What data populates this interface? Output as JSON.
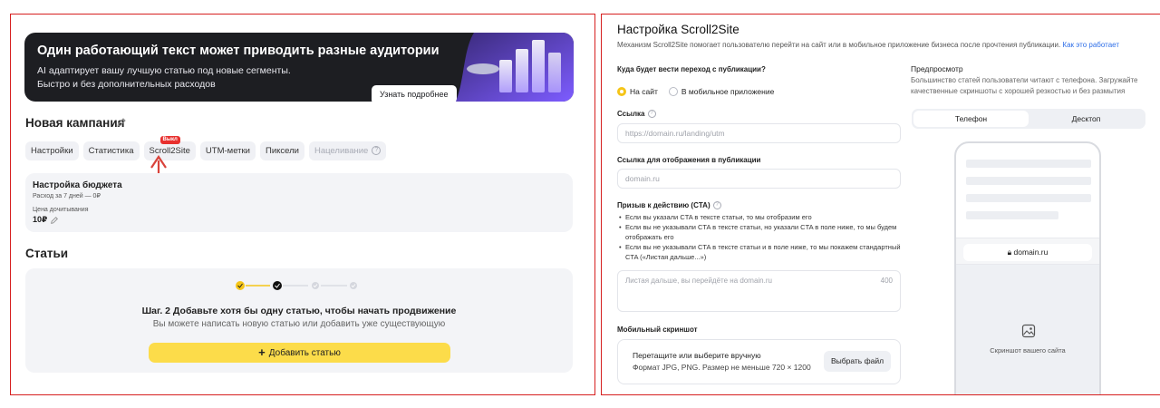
{
  "banner": {
    "title": "Один работающий текст может приводить разные аудитории",
    "line1": "AI адаптирует вашу лучшую статью под новые сегменты.",
    "line2": "Быстро и без дополнительных расходов",
    "button": "Узнать подробнее"
  },
  "campaign": {
    "title": "Новая кампания",
    "tabs": [
      {
        "label": "Настройки"
      },
      {
        "label": "Статистика"
      },
      {
        "label": "Scroll2Site",
        "badge": "Выкл"
      },
      {
        "label": "UTM-метки"
      },
      {
        "label": "Пиксели"
      },
      {
        "label": "Нацеливание"
      }
    ]
  },
  "budget": {
    "title": "Настройка бюджета",
    "spend": "Расход за 7 дней — 0₽",
    "price_label": "Цена дочитывания",
    "price": "10₽"
  },
  "articles": {
    "title": "Статьи",
    "step_title": "Шаг. 2 Добавьте хотя бы одну статью, чтобы начать продвижение",
    "step_sub": "Вы можете написать новую статью или добавить уже существующую",
    "add_button": "Добавить статью",
    "steps_total": 4,
    "steps_done": 1,
    "current_step": 2
  },
  "s2s": {
    "title": "Настройка Scroll2Site",
    "subtitle": "Механизм Scroll2Site помогает пользователю перейти на сайт или в мобильное приложение бизнеса после прочтения публикации.",
    "subtitle_link": "Как это работает",
    "dest_label": "Куда будет вести переход с публикации?",
    "dest_options": [
      "На сайт",
      "В мобильное приложение"
    ],
    "dest_selected": "На сайт",
    "link_label": "Ссылка",
    "link_placeholder": "https://domain.ru/landing/utm",
    "display_label": "Ссылка для отображения в публикации",
    "display_placeholder": "domain.ru",
    "cta_label": "Призыв к действию (CTA)",
    "cta_bullets": [
      "Если вы указали CTA в тексте статьи, то мы отобразим его",
      "Если вы не указывали CTA в тексте статьи, но указали CTA в поле ниже, то мы будем отображать его",
      "Если вы не указывали CTA в тексте статьи и в поле ниже, то мы покажем стандартный CTA («Листая дальше...»)"
    ],
    "cta_placeholder": "Листая дальше, вы перейдёте на domain.ru",
    "cta_counter": "400",
    "screenshot_label": "Мобильный скриншот",
    "upload_line1": "Перетащите или выберите вручную",
    "upload_line2": "Формат JPG, PNG. Размер не меньше 720 × 1200",
    "upload_button": "Выбрать файл"
  },
  "preview": {
    "title": "Предпросмотр",
    "subtitle": "Большинство статей пользователи читают с телефона. Загружайте качественные скриншоты с хорошей резкостью и без размытия",
    "tabs": [
      "Телефон",
      "Десктоп"
    ],
    "active_tab": "Телефон",
    "url": "domain.ru",
    "caption": "Скриншот вашего сайта"
  }
}
